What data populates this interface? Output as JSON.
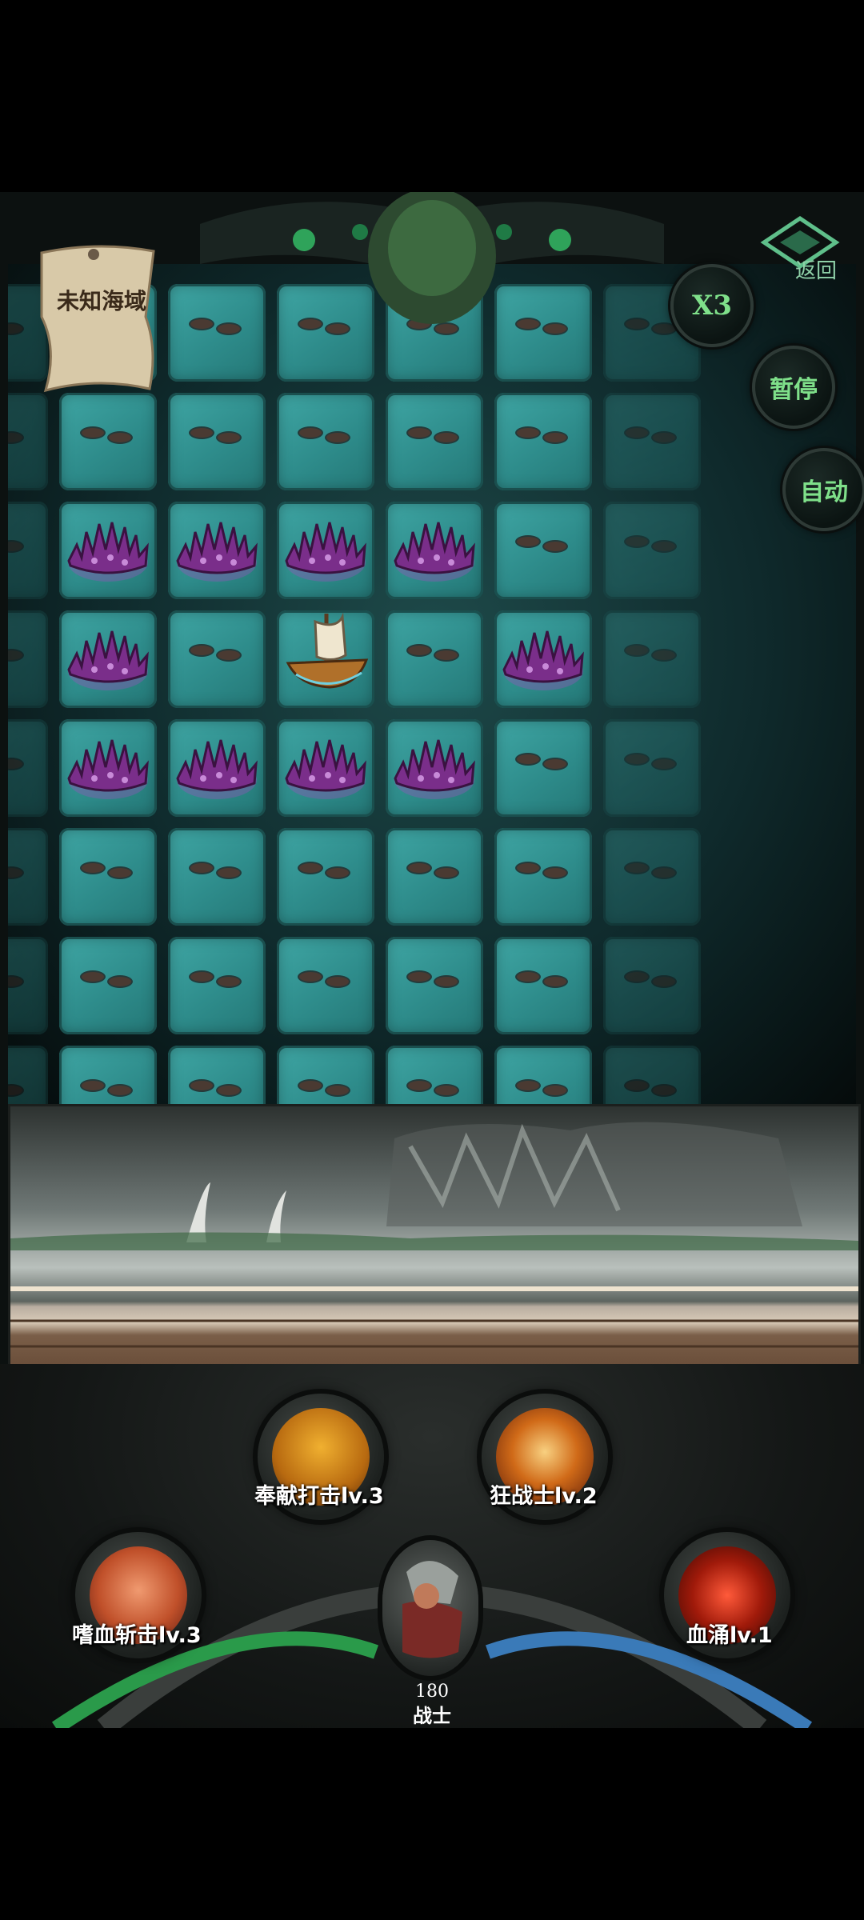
{
  "map": {
    "name": "未知海域"
  },
  "controls": {
    "back_label": "返回",
    "speed_label": "X3",
    "pause_label": "暂停",
    "auto_label": "自动"
  },
  "board": {
    "columns": 7,
    "rows": 8,
    "urchin_cells": [
      "2,1",
      "2,2",
      "2,3",
      "2,4",
      "3,1",
      "3,5",
      "4,1",
      "4,2",
      "4,3",
      "4,4"
    ],
    "ship_cell": "3,3"
  },
  "skills": [
    {
      "label": "奉献打击lv.3",
      "icon": "devotion-strike-icon"
    },
    {
      "label": "狂战士lv.2",
      "icon": "berserker-icon"
    },
    {
      "label": "嗜血斩击lv.3",
      "icon": "bloodthirst-slash-icon"
    },
    {
      "label": "血涌lv.1",
      "icon": "blood-surge-icon"
    }
  ],
  "hero": {
    "value": "180",
    "class": "战士"
  },
  "colors": {
    "accent": "#7fe08a",
    "tile": "#3fa6a4",
    "urchin": "#7a2e8a"
  }
}
